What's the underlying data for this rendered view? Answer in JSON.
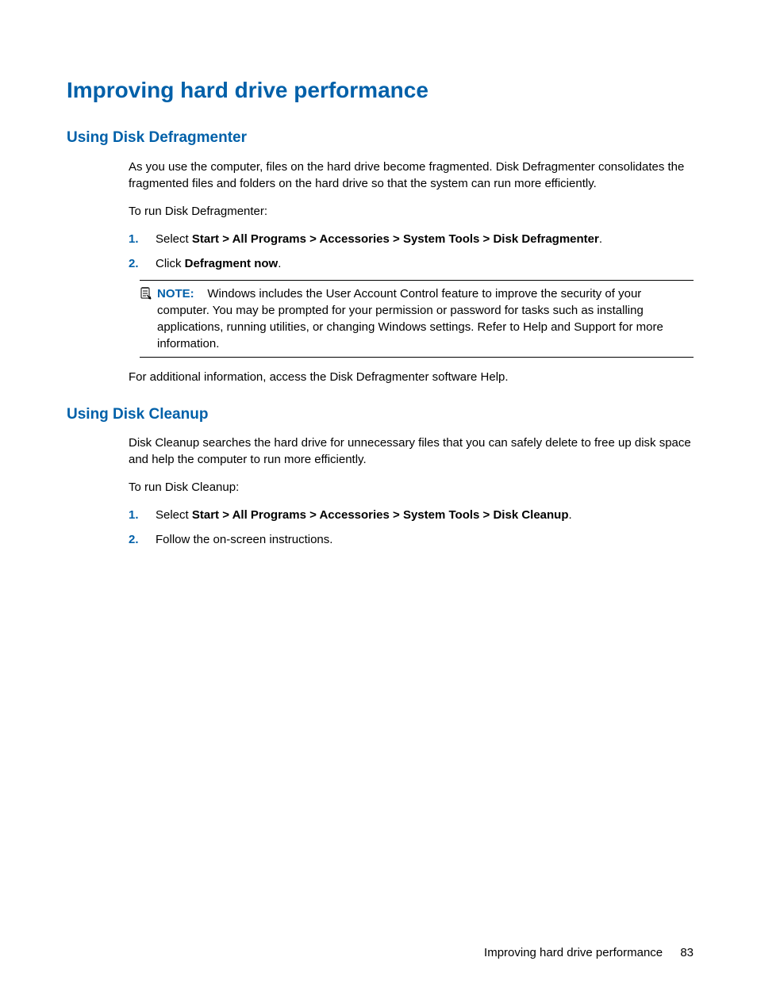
{
  "title": "Improving hard drive performance",
  "section1": {
    "heading": "Using Disk Defragmenter",
    "para1": "As you use the computer, files on the hard drive become fragmented. Disk Defragmenter consolidates the fragmented files and folders on the hard drive so that the system can run more efficiently.",
    "para2": "To run Disk Defragmenter:",
    "steps": [
      {
        "num": "1.",
        "prefix": "Select ",
        "bold": "Start > All Programs > Accessories > System Tools > Disk Defragmenter",
        "suffix": "."
      },
      {
        "num": "2.",
        "prefix": "Click ",
        "bold": "Defragment now",
        "suffix": "."
      }
    ],
    "note": {
      "label": "NOTE:",
      "text": "Windows includes the User Account Control feature to improve the security of your computer. You may be prompted for your permission or password for tasks such as installing applications, running utilities, or changing Windows settings. Refer to Help and Support for more information."
    },
    "para3": "For additional information, access the Disk Defragmenter software Help."
  },
  "section2": {
    "heading": "Using Disk Cleanup",
    "para1": "Disk Cleanup searches the hard drive for unnecessary files that you can safely delete to free up disk space and help the computer to run more efficiently.",
    "para2": "To run Disk Cleanup:",
    "steps": [
      {
        "num": "1.",
        "prefix": "Select ",
        "bold": "Start > All Programs > Accessories > System Tools > Disk Cleanup",
        "suffix": "."
      },
      {
        "num": "2.",
        "prefix": "Follow the on-screen instructions.",
        "bold": "",
        "suffix": ""
      }
    ]
  },
  "footer": {
    "text": "Improving hard drive performance",
    "page": "83"
  }
}
